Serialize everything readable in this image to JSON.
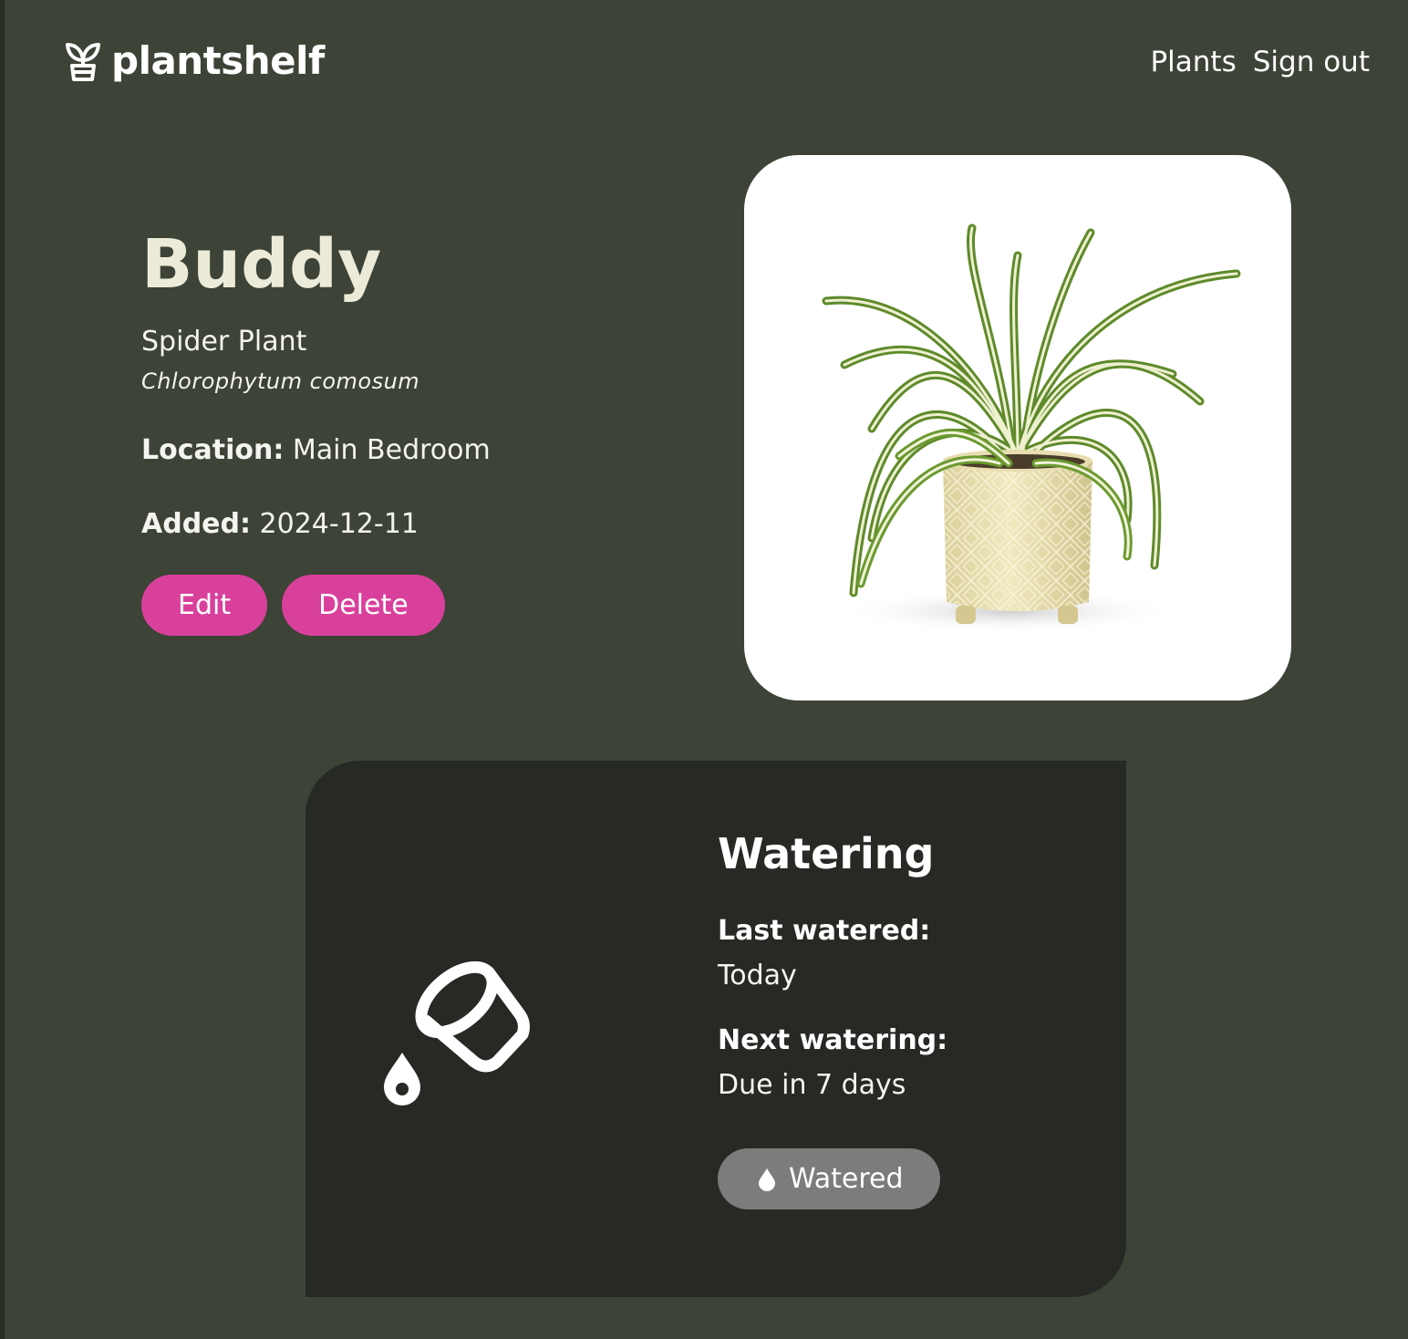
{
  "app": {
    "name": "plantshelf",
    "logo_icon": "sprout-pot-icon"
  },
  "nav": {
    "plants_label": "Plants",
    "signout_label": "Sign out"
  },
  "plant": {
    "name": "Buddy",
    "common_name": "Spider Plant",
    "scientific_name": "Chlorophytum comosum",
    "location_label": "Location:",
    "location_value": "Main Bedroom",
    "added_label": "Added:",
    "added_value": "2024-12-11",
    "photo_alt": "Spider plant in a cream ceramic pot"
  },
  "actions": {
    "edit_label": "Edit",
    "delete_label": "Delete"
  },
  "watering": {
    "title": "Watering",
    "icon": "watering-pot-pouring-icon",
    "last_label": "Last watered:",
    "last_value": "Today",
    "next_label": "Next watering:",
    "next_value": "Due in 7 days",
    "watered_button_label": "Watered",
    "watered_button_icon": "water-drop-icon"
  },
  "colors": {
    "background": "#3d4336",
    "panel": "#262924",
    "accent_pink": "#d9409c",
    "title_cream": "#ecebd9",
    "disabled_gray": "#7c7c7c"
  }
}
